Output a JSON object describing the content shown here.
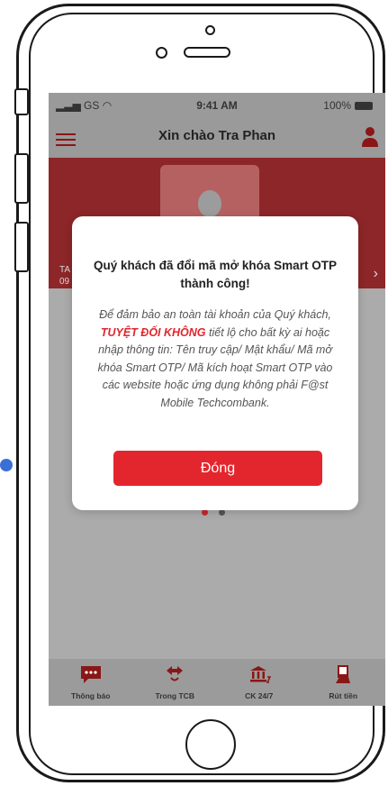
{
  "status_bar": {
    "carrier": "GS",
    "time": "9:41 AM",
    "battery": "100%"
  },
  "header": {
    "title": "Xin chào Tra Phan"
  },
  "banner": {
    "text_line1": "TA",
    "text_line2": "09"
  },
  "modal": {
    "title": "Quý khách đã đổi mã mở khóa Smart OTP thành công!",
    "body_prefix": "Để đảm bảo an toàn tài khoản của Quý khách,",
    "body_warning": "TUYỆT ĐỐI KHÔNG",
    "body_suffix": "tiết lộ cho bất kỳ ai hoặc nhập thông tin: Tên truy cập/ Mật khẩu/ Mã mở khóa Smart OTP/ Mã kích hoạt Smart OTP vào các website hoặc ứng dụng không phải F@st Mobile Techcombank.",
    "button_label": "Đóng"
  },
  "tab_bar": [
    {
      "label": "Thông báo",
      "icon": "chat-icon"
    },
    {
      "label": "Trong TCB",
      "icon": "transfer-icon"
    },
    {
      "label": "CK 24/7",
      "icon": "bank-icon"
    },
    {
      "label": "Rút tiền",
      "icon": "cash-withdraw-icon"
    }
  ],
  "colors": {
    "brand_red": "#e3262e",
    "overlay_gray": "#ababab",
    "banner_red": "#8d2628"
  },
  "carousel": {
    "total_pages": 2,
    "active_index": 0
  }
}
